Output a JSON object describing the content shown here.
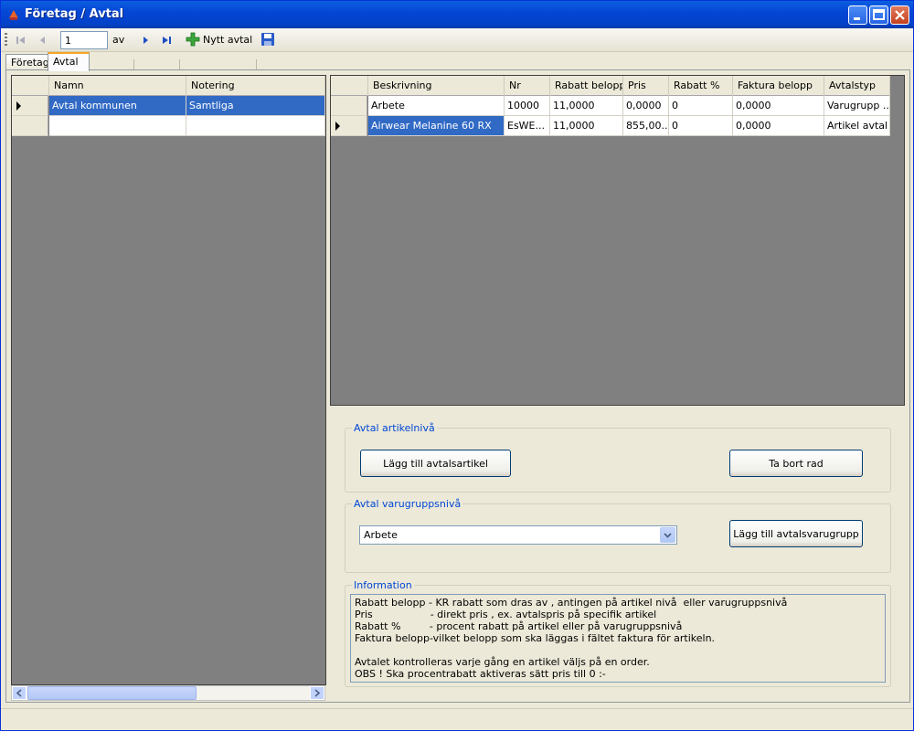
{
  "window": {
    "title": "Företag / Avtal"
  },
  "toolbar": {
    "record_position": "1",
    "record_of": "av",
    "new_label": "Nytt avtal"
  },
  "tabs": [
    {
      "label": "Företag"
    },
    {
      "label": "Avtal"
    }
  ],
  "left_grid": {
    "columns": [
      "Namn",
      "Notering"
    ],
    "rows": [
      {
        "namn": "Avtal kommunen",
        "notering": "Samtliga"
      },
      {
        "namn": "",
        "notering": ""
      }
    ]
  },
  "right_grid": {
    "columns": [
      "Beskrivning",
      "Nr",
      "Rabatt belopp",
      "Pris",
      "Rabatt %",
      "Faktura belopp",
      "Avtalstyp"
    ],
    "rows": [
      {
        "beskrivning": "Arbete",
        "nr": "10000",
        "rabatt_belopp": "11,0000",
        "pris": "0,0000",
        "rabatt_pct": "0",
        "faktura_belopp": "0,0000",
        "avtalstyp": "Varugrupp ..."
      },
      {
        "beskrivning": "Airwear Melanine 60 RX",
        "nr": "EsWE...",
        "rabatt_belopp": "11,0000",
        "pris": "855,00...",
        "rabatt_pct": "0",
        "faktura_belopp": "0,0000",
        "avtalstyp": "Artikel avtal"
      }
    ]
  },
  "artikel": {
    "legend": "Avtal artikelnivå",
    "add_label": "Lägg till avtalsartikel",
    "remove_label": "Ta bort rad"
  },
  "varugrupp": {
    "legend": "Avtal varugruppsnivå",
    "selected": "Arbete",
    "add_label": "Lägg till avtalsvarugrupp"
  },
  "information": {
    "legend": "Information",
    "text": "Rabatt belopp - KR rabatt som dras av , antingen på artikel nivå  eller varugruppsnivå\nPris                  - direkt pris , ex. avtalspris på specifik artikel\nRabatt %         - procent rabatt på artikel eller på varugruppsnivå\nFaktura belopp-vilket belopp som ska läggas i fältet faktura för artikeln.\n\nAvtalet kontrolleras varje gång en artikel väljs på en order.\nOBS ! Ska procentrabatt aktiveras sätt pris till 0 :-"
  },
  "icons": [
    "app-icon",
    "first-record-icon",
    "prev-record-icon",
    "next-record-icon",
    "last-record-icon",
    "add-icon",
    "save-icon"
  ],
  "colors": {
    "titlebar": "#0546d6",
    "selection": "#316ac5",
    "legend": "#0046d5",
    "grid_bg": "#808080"
  }
}
